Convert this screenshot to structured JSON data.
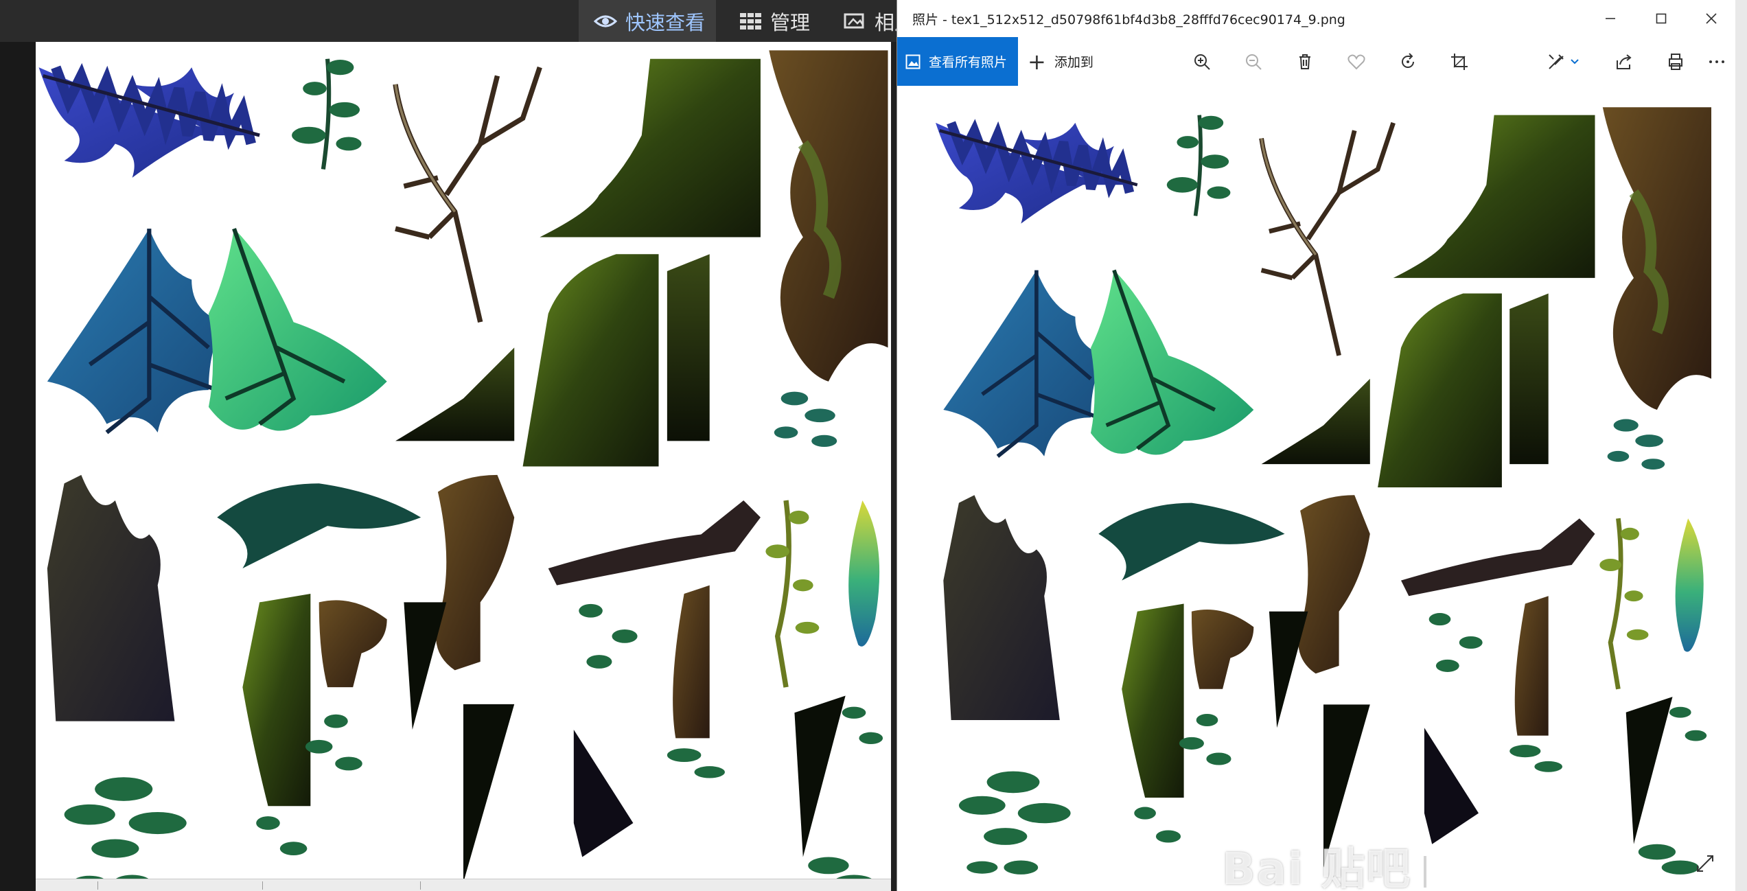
{
  "explorer": {
    "tabs": [
      {
        "label": "快速查看",
        "icon": "eye-icon"
      },
      {
        "label": "管理",
        "icon": "grid-icon"
      },
      {
        "label": "相片",
        "icon": "photos-icon"
      }
    ]
  },
  "photos_window": {
    "title": "照片 - tex1_512x512_d50798f61bf4d3b8_28fffd76cec90174_9.png",
    "see_all_label": "查看所有照片",
    "add_to_label": "添加到",
    "window_controls": [
      "minimize-icon",
      "maximize-icon",
      "close-icon"
    ],
    "toolbar_icons": [
      "zoom-in-icon",
      "zoom-out-icon",
      "delete-icon",
      "favorite-icon",
      "rotate-icon",
      "crop-icon",
      "edit-icon",
      "share-icon",
      "print-icon",
      "more-icon"
    ]
  },
  "watermark": {
    "text": "Bai 贴吧"
  },
  "colors": {
    "accent": "#0b6fd1",
    "explorer_ribbon": "#2b2b2b",
    "quickview_tab": "#3d3d3d"
  }
}
